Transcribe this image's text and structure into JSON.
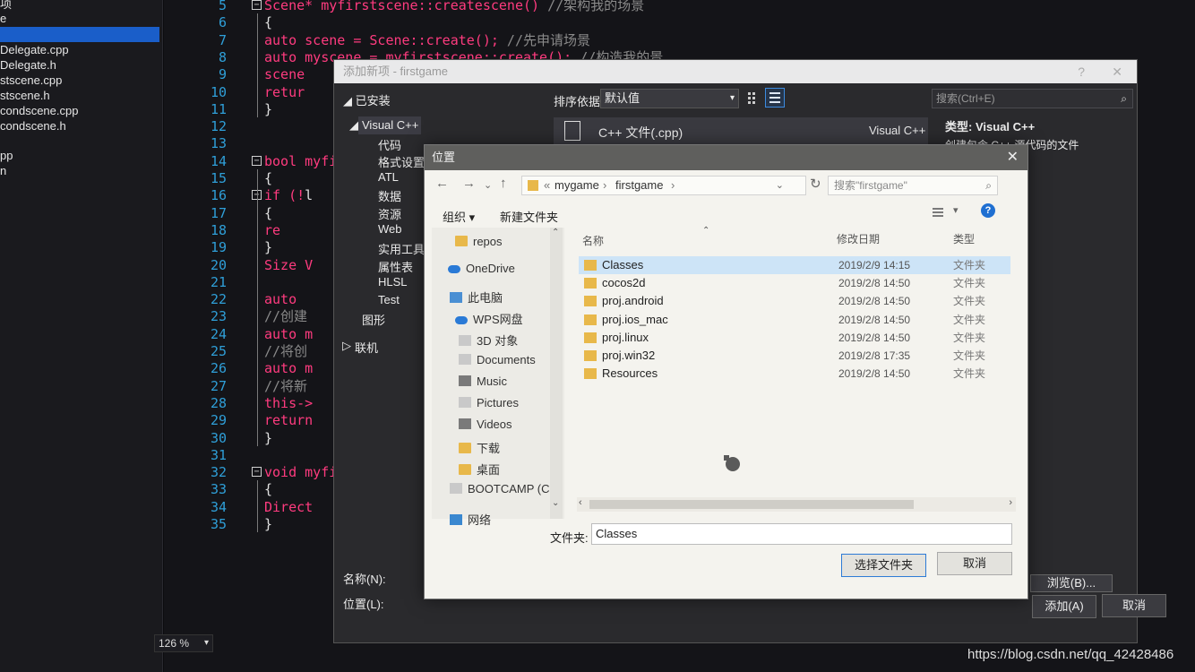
{
  "solution_items": [
    {
      "label": "项",
      "selected": false
    },
    {
      "label": "e",
      "selected": false
    },
    {
      "label": "",
      "selected": true
    },
    {
      "label": "Delegate.cpp",
      "selected": false
    },
    {
      "label": "Delegate.h",
      "selected": false
    },
    {
      "label": "stscene.cpp",
      "selected": false
    },
    {
      "label": "stscene.h",
      "selected": false
    },
    {
      "label": "condscene.cpp",
      "selected": false
    },
    {
      "label": "condscene.h",
      "selected": false
    },
    {
      "label": "pp",
      "selected": false
    },
    {
      "label": "n",
      "selected": false
    }
  ],
  "editor": {
    "line_numbers": [
      "5",
      "6",
      "7",
      "8",
      "9",
      "10",
      "11",
      "12",
      "13",
      "14",
      "15",
      "16",
      "17",
      "18",
      "19",
      "20",
      "21",
      "22",
      "23",
      "24",
      "25",
      "26",
      "27",
      "28",
      "29",
      "30",
      "31",
      "32",
      "33",
      "34",
      "35"
    ],
    "lines": [
      {
        "segments": [
          {
            "t": "Scene* myfirstscene::createscene()",
            "c": "kw"
          },
          {
            "t": "    //架构我的场景",
            "c": "cm"
          }
        ]
      },
      {
        "segments": [
          {
            "t": "{",
            "c": ""
          }
        ]
      },
      {
        "segments": [
          {
            "t": "    auto scene = Scene::create();",
            "c": "kw"
          },
          {
            "t": "          //先申请场景",
            "c": "cm"
          }
        ]
      },
      {
        "segments": [
          {
            "t": "    auto myscene = myfirstscene::create();",
            "c": "kw"
          },
          {
            "t": "  //构造我的景",
            "c": "cm"
          }
        ]
      },
      {
        "segments": [
          {
            "t": "    scene",
            "c": "kw"
          }
        ]
      },
      {
        "segments": [
          {
            "t": "    retur",
            "c": "kw"
          }
        ]
      },
      {
        "segments": [
          {
            "t": "}",
            "c": ""
          }
        ]
      },
      {
        "segments": []
      },
      {
        "segments": []
      },
      {
        "segments": [
          {
            "t": "bool myfir",
            "c": "kw"
          }
        ]
      },
      {
        "segments": [
          {
            "t": "{",
            "c": ""
          }
        ]
      },
      {
        "segments": [
          {
            "t": "    if (!",
            "c": "kw"
          },
          {
            "t": "l",
            "c": ""
          }
        ]
      },
      {
        "segments": [
          {
            "t": "    {",
            "c": ""
          }
        ]
      },
      {
        "segments": [
          {
            "t": "        re",
            "c": "kw"
          }
        ]
      },
      {
        "segments": [
          {
            "t": "    }",
            "c": ""
          }
        ]
      },
      {
        "segments": [
          {
            "t": "    Size V",
            "c": "kw"
          }
        ]
      },
      {
        "segments": []
      },
      {
        "segments": [
          {
            "t": "    auto ",
            "c": "kw"
          }
        ]
      },
      {
        "segments": [
          {
            "t": "    //创建",
            "c": "cm"
          }
        ]
      },
      {
        "segments": [
          {
            "t": "    auto m",
            "c": "kw"
          }
        ]
      },
      {
        "segments": [
          {
            "t": "    //将创",
            "c": "cm"
          }
        ]
      },
      {
        "segments": [
          {
            "t": "    auto m",
            "c": "kw"
          }
        ]
      },
      {
        "segments": [
          {
            "t": "    //将新",
            "c": "cm"
          }
        ]
      },
      {
        "segments": [
          {
            "t": "    this->",
            "c": "kw"
          }
        ]
      },
      {
        "segments": [
          {
            "t": "    return",
            "c": "kw"
          }
        ]
      },
      {
        "segments": [
          {
            "t": "}",
            "c": ""
          }
        ]
      },
      {
        "segments": []
      },
      {
        "segments": [
          {
            "t": "void myfir",
            "c": "kw"
          }
        ]
      },
      {
        "segments": [
          {
            "t": "{",
            "c": ""
          }
        ]
      },
      {
        "segments": [
          {
            "t": "    Direct",
            "c": "kw"
          }
        ]
      },
      {
        "segments": [
          {
            "t": "}",
            "c": ""
          }
        ]
      }
    ],
    "zoom": "126 %"
  },
  "add_dialog": {
    "title": "添加新项 - firstgame",
    "installed": "已安装",
    "sort_label": "排序依据:",
    "sort_value": "默认值",
    "search_placeholder": "搜索(Ctrl+E)",
    "tree": [
      "Visual C++",
      "代码",
      "格式设置",
      "ATL",
      "数据",
      "资源",
      "Web",
      "实用工具",
      "属性表",
      "HLSL",
      "Test",
      "图形",
      "联机"
    ],
    "template_name": "C++ 文件(.cpp)",
    "template_lang": "Visual C++",
    "type_label": "类型:",
    "type_value": "Visual C++",
    "type_desc": "创建包含 C++ 源代码的文件",
    "name_label": "名称(N):",
    "location_label": "位置(L):",
    "browse_label": "浏览(B)...",
    "add_button": "添加(A)",
    "cancel_button": "取消"
  },
  "location_dialog": {
    "title": "位置",
    "breadcrumb": [
      "mygame",
      "firstgame"
    ],
    "search_placeholder": "搜索\"firstgame\"",
    "organize": "组织 ▾",
    "new_folder": "新建文件夹",
    "nav": [
      {
        "label": "repos",
        "icon": "folder"
      },
      {
        "label": "OneDrive",
        "icon": "cloud"
      },
      {
        "label": "此电脑",
        "icon": "pc"
      },
      {
        "label": "WPS网盘",
        "icon": "cloud"
      },
      {
        "label": "3D 对象",
        "icon": "doc"
      },
      {
        "label": "Documents",
        "icon": "doc"
      },
      {
        "label": "Music",
        "icon": "music"
      },
      {
        "label": "Pictures",
        "icon": "doc"
      },
      {
        "label": "Videos",
        "icon": "music"
      },
      {
        "label": "下载",
        "icon": "folder"
      },
      {
        "label": "桌面",
        "icon": "folder"
      },
      {
        "label": "BOOTCAMP (C:",
        "icon": "doc"
      },
      {
        "label": "网络",
        "icon": "net"
      }
    ],
    "columns": {
      "name": "名称",
      "date": "修改日期",
      "type": "类型"
    },
    "files": [
      {
        "name": "Classes",
        "date": "2019/2/9 14:15",
        "type": "文件夹",
        "selected": true
      },
      {
        "name": "cocos2d",
        "date": "2019/2/8 14:50",
        "type": "文件夹",
        "selected": false
      },
      {
        "name": "proj.android",
        "date": "2019/2/8 14:50",
        "type": "文件夹",
        "selected": false
      },
      {
        "name": "proj.ios_mac",
        "date": "2019/2/8 14:50",
        "type": "文件夹",
        "selected": false
      },
      {
        "name": "proj.linux",
        "date": "2019/2/8 14:50",
        "type": "文件夹",
        "selected": false
      },
      {
        "name": "proj.win32",
        "date": "2019/2/8 17:35",
        "type": "文件夹",
        "selected": false
      },
      {
        "name": "Resources",
        "date": "2019/2/8 14:50",
        "type": "文件夹",
        "selected": false
      }
    ],
    "folder_label": "文件夹:",
    "folder_value": "Classes",
    "select_button": "选择文件夹",
    "cancel_button": "取消"
  },
  "watermark": "https://blog.csdn.net/qq_42428486"
}
